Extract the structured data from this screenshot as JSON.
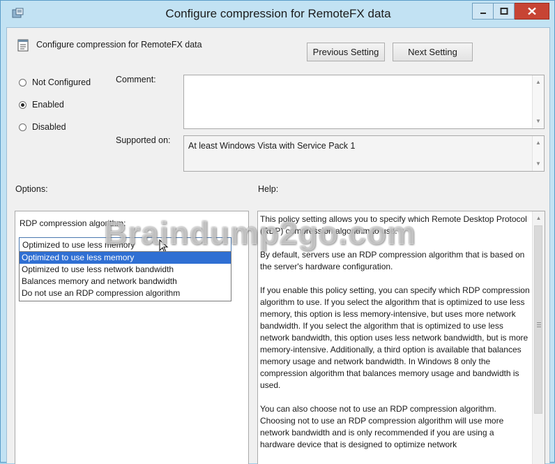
{
  "window": {
    "title": "Configure compression for RemoteFX data",
    "controls": {
      "minimize": "minimize-icon",
      "maximize": "maximize-icon",
      "close": "close-icon"
    }
  },
  "policy": {
    "name": "Configure compression for RemoteFX data",
    "previous_label": "Previous Setting",
    "next_label": "Next Setting"
  },
  "state": {
    "options": [
      {
        "label": "Not Configured",
        "selected": false
      },
      {
        "label": "Enabled",
        "selected": true
      },
      {
        "label": "Disabled",
        "selected": false
      }
    ]
  },
  "comment": {
    "label": "Comment:",
    "value": ""
  },
  "supported": {
    "label": "Supported on:",
    "value": "At least Windows Vista with Service Pack 1"
  },
  "options_section": {
    "label": "Options:",
    "algorithm_label": "RDP compression algorithm:",
    "selected_value": "Optimized to use less memory",
    "dropdown_items": [
      "Optimized to use less memory",
      "Optimized to use less network bandwidth",
      "Balances memory and network bandwidth",
      "Do not use an RDP compression algorithm"
    ]
  },
  "help_section": {
    "label": "Help:",
    "paragraphs": [
      "This policy setting allows you to specify which Remote Desktop Protocol (RDP) compression algorithm to use.",
      "By default, servers use an RDP compression algorithm that is based on the server's hardware configuration.",
      "If you enable this policy setting, you can specify which RDP compression algorithm to use. If you select the algorithm that is optimized to use less memory, this option is less memory-intensive, but uses more network bandwidth. If you select the algorithm that is optimized to use less network bandwidth, this option uses less network bandwidth, but is more memory-intensive. Additionally, a third option is available that balances memory usage and network bandwidth. In Windows 8 only the compression algorithm that balances memory usage and bandwidth is used.",
      "You can also choose not to use an RDP compression algorithm. Choosing not to use an RDP compression algorithm will use more network bandwidth and is only recommended if you are using a hardware device that is designed to optimize network"
    ]
  },
  "watermark": "Braindump2go.com"
}
